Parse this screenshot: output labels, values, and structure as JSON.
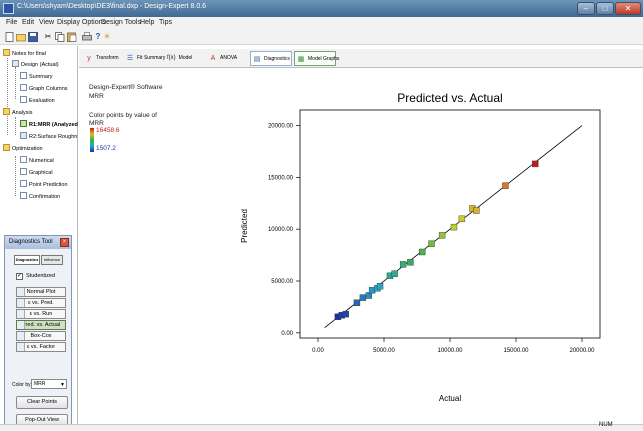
{
  "window": {
    "title": "C:\\Users\\shyam\\Desktop\\DE3\\final.dxp - Design-Expert 8.0.6"
  },
  "menubar": {
    "items": [
      "File",
      "Edit",
      "View",
      "Display Options",
      "Design Tools",
      "Help",
      "Tips"
    ]
  },
  "toolbar": {
    "icons": [
      "new-file-icon",
      "open-folder-icon",
      "save-icon",
      "cut-icon",
      "copy-icon",
      "paste-icon",
      "print-icon",
      "help-icon",
      "tips-icon"
    ]
  },
  "tree": {
    "root": "Notes for final",
    "design": "Design (Actual)",
    "summary": "Summary",
    "graph_columns": "Graph Columns",
    "evaluation": "Evaluation",
    "analysis": "Analysis",
    "r1": "R1:MRR (Analyzed",
    "r2": "R2:Surface Roughn",
    "optimization": "Optimization",
    "numerical": "Numerical",
    "graphical": "Graphical",
    "point_prediction": "Point Prediction",
    "confirmation": "Confirmation"
  },
  "diagnostics_tool": {
    "title": "Diagnostics Tool",
    "tab_diagnostics": "Diagnostics",
    "tab_influence": "Influence",
    "studentized_label": "Studentized",
    "studentized_checked": true,
    "buttons": [
      "Normal Plot",
      "ε vs. Pred.",
      "ε vs. Run",
      "Pred. vs. Actual",
      "Box-Cox",
      "ε vs. Factor"
    ],
    "active_button": "Pred. vs. Actual",
    "color_by_label": "Color by",
    "color_by_value": "MRR",
    "clear_points": "Clear Points",
    "pop_out_view": "Pop-Out View"
  },
  "tabs": {
    "transform": "Transform",
    "fit_summary": "Fit Summary",
    "model": "Model",
    "anova": "ANOVA",
    "diagnostics": "Diagnostics",
    "model_graphs": "Model Graphs",
    "fx_symbol": "f(x)"
  },
  "info": {
    "software": "Design-Expert® Software",
    "response": "MRR",
    "color_points_label": "Color points by value of",
    "color_points_var": "MRR",
    "max_value": "16458.6",
    "min_value": "1507.2",
    "colors": {
      "high": "#c01c1c",
      "low": "#1c2fa8"
    }
  },
  "statusbar": {
    "num": "NUM"
  },
  "chart_data": {
    "type": "scatter",
    "title": "Predicted vs. Actual",
    "xlabel": "Actual",
    "ylabel": "Predicted",
    "xlim": [
      0,
      20000
    ],
    "ylim": [
      -500,
      21500
    ],
    "x_ticks": [
      "0.00",
      "5000.00",
      "10000.00",
      "15000.00",
      "20000.00"
    ],
    "y_ticks": [
      "0.00",
      "5000.00",
      "10000.00",
      "15000.00",
      "20000.00"
    ],
    "x_tick_values": [
      0,
      5000,
      10000,
      15000,
      20000
    ],
    "y_tick_values": [
      0,
      5000,
      10000,
      15000,
      20000
    ],
    "reference_line": "y = x",
    "color_range": [
      1507.2,
      16458.6
    ],
    "points": [
      {
        "x": 1507.2,
        "y": 1550
      },
      {
        "x": 1800,
        "y": 1700
      },
      {
        "x": 2100,
        "y": 1800
      },
      {
        "x": 2950,
        "y": 2900
      },
      {
        "x": 3400,
        "y": 3400
      },
      {
        "x": 3850,
        "y": 3600
      },
      {
        "x": 4100,
        "y": 4100
      },
      {
        "x": 4500,
        "y": 4300
      },
      {
        "x": 4700,
        "y": 4500
      },
      {
        "x": 5450,
        "y": 5500
      },
      {
        "x": 5800,
        "y": 5700
      },
      {
        "x": 6450,
        "y": 6600
      },
      {
        "x": 7000,
        "y": 6800
      },
      {
        "x": 7900,
        "y": 7800
      },
      {
        "x": 8600,
        "y": 8600
      },
      {
        "x": 9400,
        "y": 9400
      },
      {
        "x": 10300,
        "y": 10200
      },
      {
        "x": 10900,
        "y": 11000
      },
      {
        "x": 11700,
        "y": 12000
      },
      {
        "x": 12000,
        "y": 11800
      },
      {
        "x": 14200,
        "y": 14200
      },
      {
        "x": 16458.6,
        "y": 16300
      }
    ]
  }
}
